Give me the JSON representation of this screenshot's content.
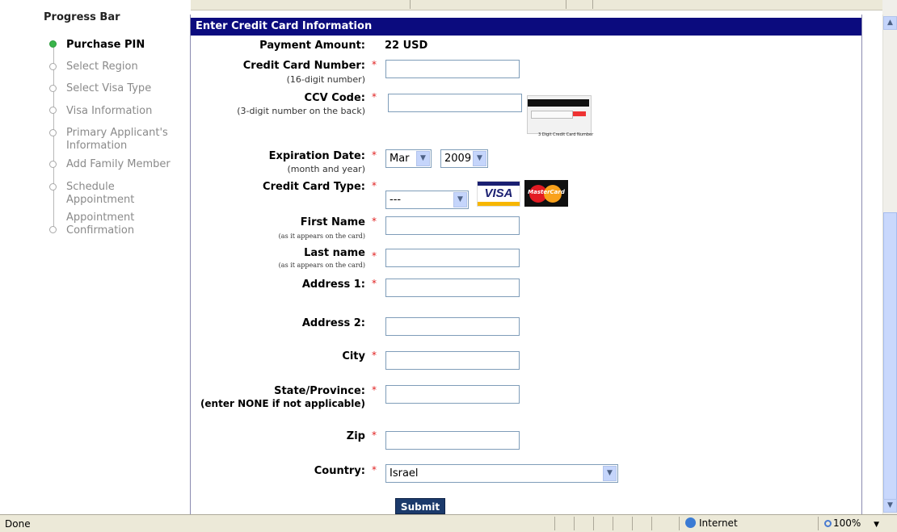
{
  "progress": {
    "title": "Progress Bar",
    "steps": [
      {
        "label": "Purchase PIN"
      },
      {
        "label": "Select Region"
      },
      {
        "label": "Select Visa Type"
      },
      {
        "label": "Visa Information"
      },
      {
        "label": "Primary Applicant's\nInformation"
      },
      {
        "label": "Add Family Member"
      },
      {
        "label": "Schedule\nAppointment"
      },
      {
        "label": "Appointment\nConfirmation"
      }
    ]
  },
  "form": {
    "header": "Enter Credit Card Information",
    "payment_label": "Payment Amount:",
    "payment_value": "22 USD",
    "required_mark": "*",
    "cc_number": {
      "label": "Credit Card Number:",
      "hint": "(16-digit number)",
      "value": ""
    },
    "ccv": {
      "label": "CCV Code:",
      "hint": "(3-digit number on the back)",
      "value": ""
    },
    "ccv_image_caption": "3 Digit Credit Card Number",
    "expiration": {
      "label": "Expiration Date:",
      "hint": "(month and year)",
      "month": "Mar",
      "year": "2009"
    },
    "card_type": {
      "label": "Credit Card Type:",
      "selected": "---"
    },
    "card_logos": {
      "visa": "VISA",
      "mastercard": "MasterCard"
    },
    "first_name": {
      "label": "First Name",
      "hint": "(as it appears on the card)",
      "value": ""
    },
    "last_name": {
      "label": "Last name",
      "hint": "(as it appears on the card)",
      "value": ""
    },
    "address1": {
      "label": "Address 1:",
      "value": ""
    },
    "address2": {
      "label": "Address 2:",
      "value": ""
    },
    "city": {
      "label": "City",
      "value": ""
    },
    "state": {
      "label": "State/Province:",
      "hint": "(enter NONE if not applicable)",
      "value": ""
    },
    "zip": {
      "label": "Zip",
      "value": ""
    },
    "country": {
      "label": "Country:",
      "selected": "Israel"
    },
    "submit_label": "Submit"
  },
  "statusbar": {
    "status": "Done",
    "zone": "Internet",
    "zoom": "100%"
  },
  "colors": {
    "header_bg": "#0b0b7e",
    "active_dot": "#39b54a",
    "required": "#e02020",
    "submit_bg": "#1b3a6b"
  }
}
